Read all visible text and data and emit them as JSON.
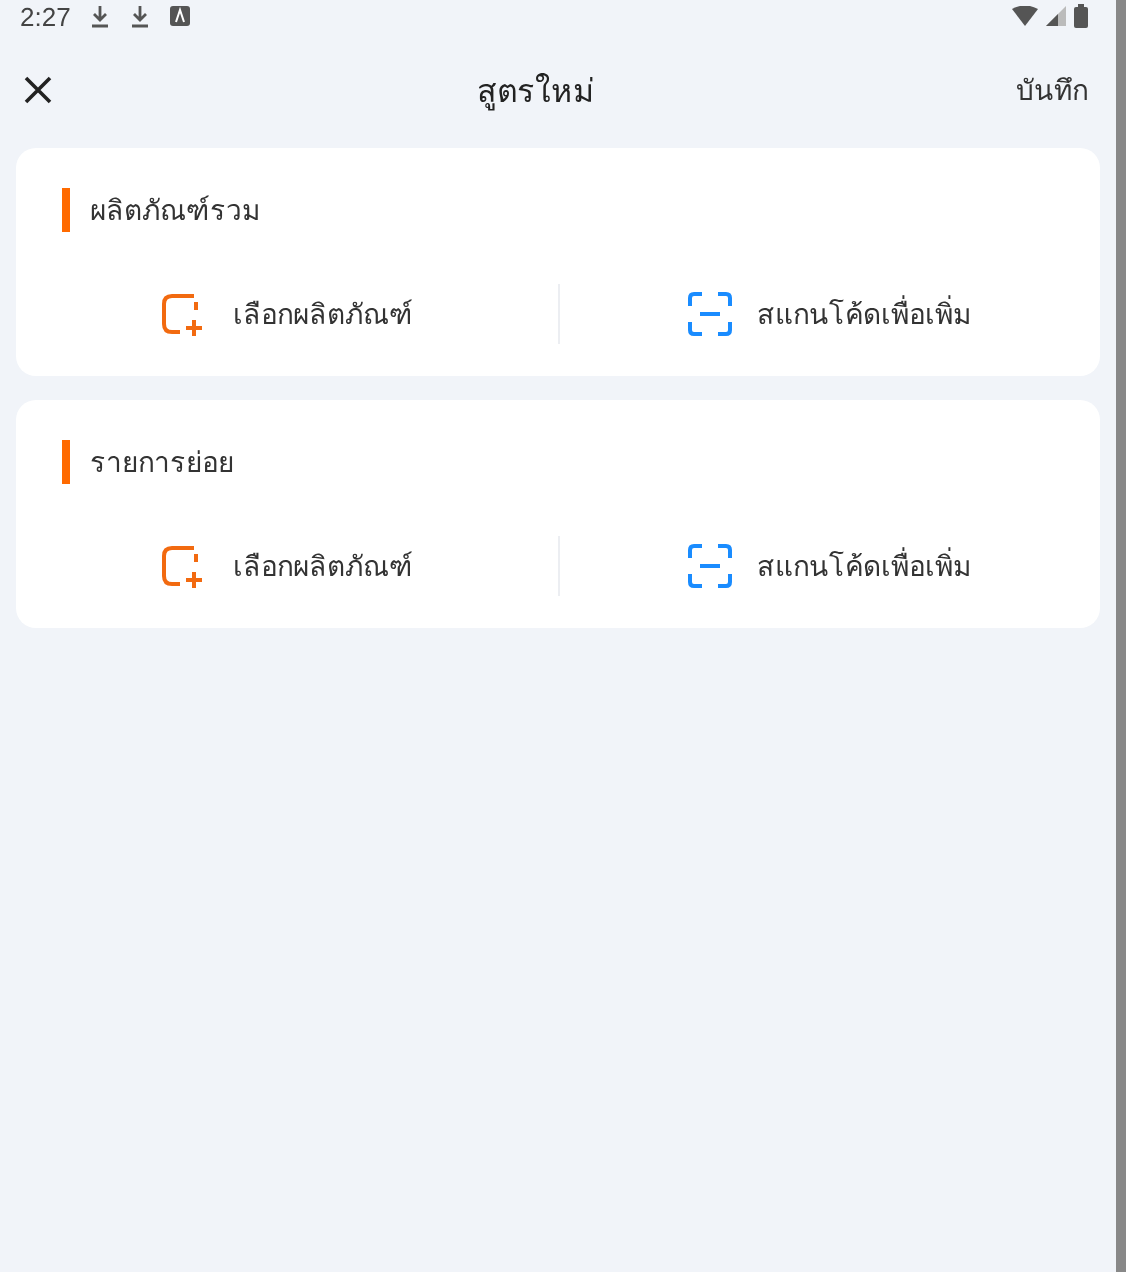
{
  "status_bar": {
    "time": "2:27"
  },
  "header": {
    "title": "สูตรใหม่",
    "action": "บันทึก"
  },
  "sections": [
    {
      "title": "ผลิตภัณฑ์รวม",
      "actions": [
        {
          "kind": "select",
          "label": "เลือกผลิตภัณฑ์"
        },
        {
          "kind": "scan",
          "label": "สแกนโค้ดเพื่อเพิ่ม"
        }
      ]
    },
    {
      "title": "รายการย่อย",
      "actions": [
        {
          "kind": "select",
          "label": "เลือกผลิตภัณฑ์"
        },
        {
          "kind": "scan",
          "label": "สแกนโค้ดเพื่อเพิ่ม"
        }
      ]
    }
  ]
}
